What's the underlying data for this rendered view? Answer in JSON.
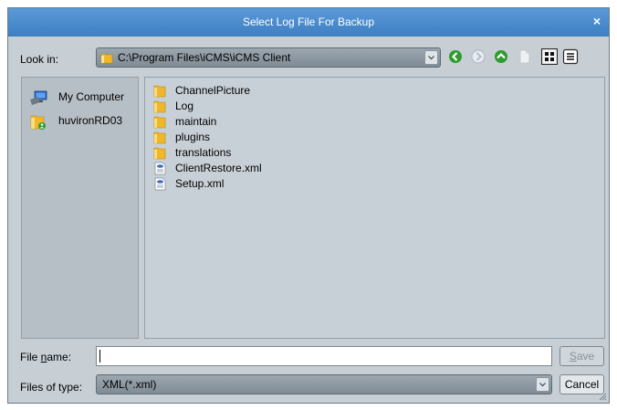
{
  "dialog": {
    "title": "Select Log File For Backup",
    "close_glyph": "×"
  },
  "lookin": {
    "label": "Look in:",
    "path": "C:\\Program Files\\iCMS\\iCMS Client"
  },
  "toolbar": {
    "icons": [
      "back-icon",
      "forward-icon",
      "up-folder-icon",
      "new-folder-icon",
      "list-view-icon",
      "details-view-icon"
    ]
  },
  "places": [
    {
      "label": "My Computer",
      "icon": "computer-icon"
    },
    {
      "label": "huvironRD03",
      "icon": "user-folder-icon"
    }
  ],
  "files": [
    {
      "name": "ChannelPicture",
      "type": "folder"
    },
    {
      "name": "Log",
      "type": "folder"
    },
    {
      "name": "maintain",
      "type": "folder"
    },
    {
      "name": "plugins",
      "type": "folder"
    },
    {
      "name": "translations",
      "type": "folder"
    },
    {
      "name": "ClientRestore.xml",
      "type": "xml"
    },
    {
      "name": "Setup.xml",
      "type": "xml"
    }
  ],
  "filename": {
    "label_prefix": "File ",
    "label_mnemonic": "n",
    "label_suffix": "ame:",
    "value": ""
  },
  "filetype": {
    "label": "Files of type:",
    "selected": "XML(*.xml)"
  },
  "buttons": {
    "save_mnemonic": "S",
    "save_rest": "ave",
    "cancel": "Cancel"
  },
  "colors": {
    "titlebar": "#4a8bcf",
    "dialog_bg": "#c7ced4",
    "folder": "#f0b829",
    "nav_green": "#2e9c2e"
  }
}
